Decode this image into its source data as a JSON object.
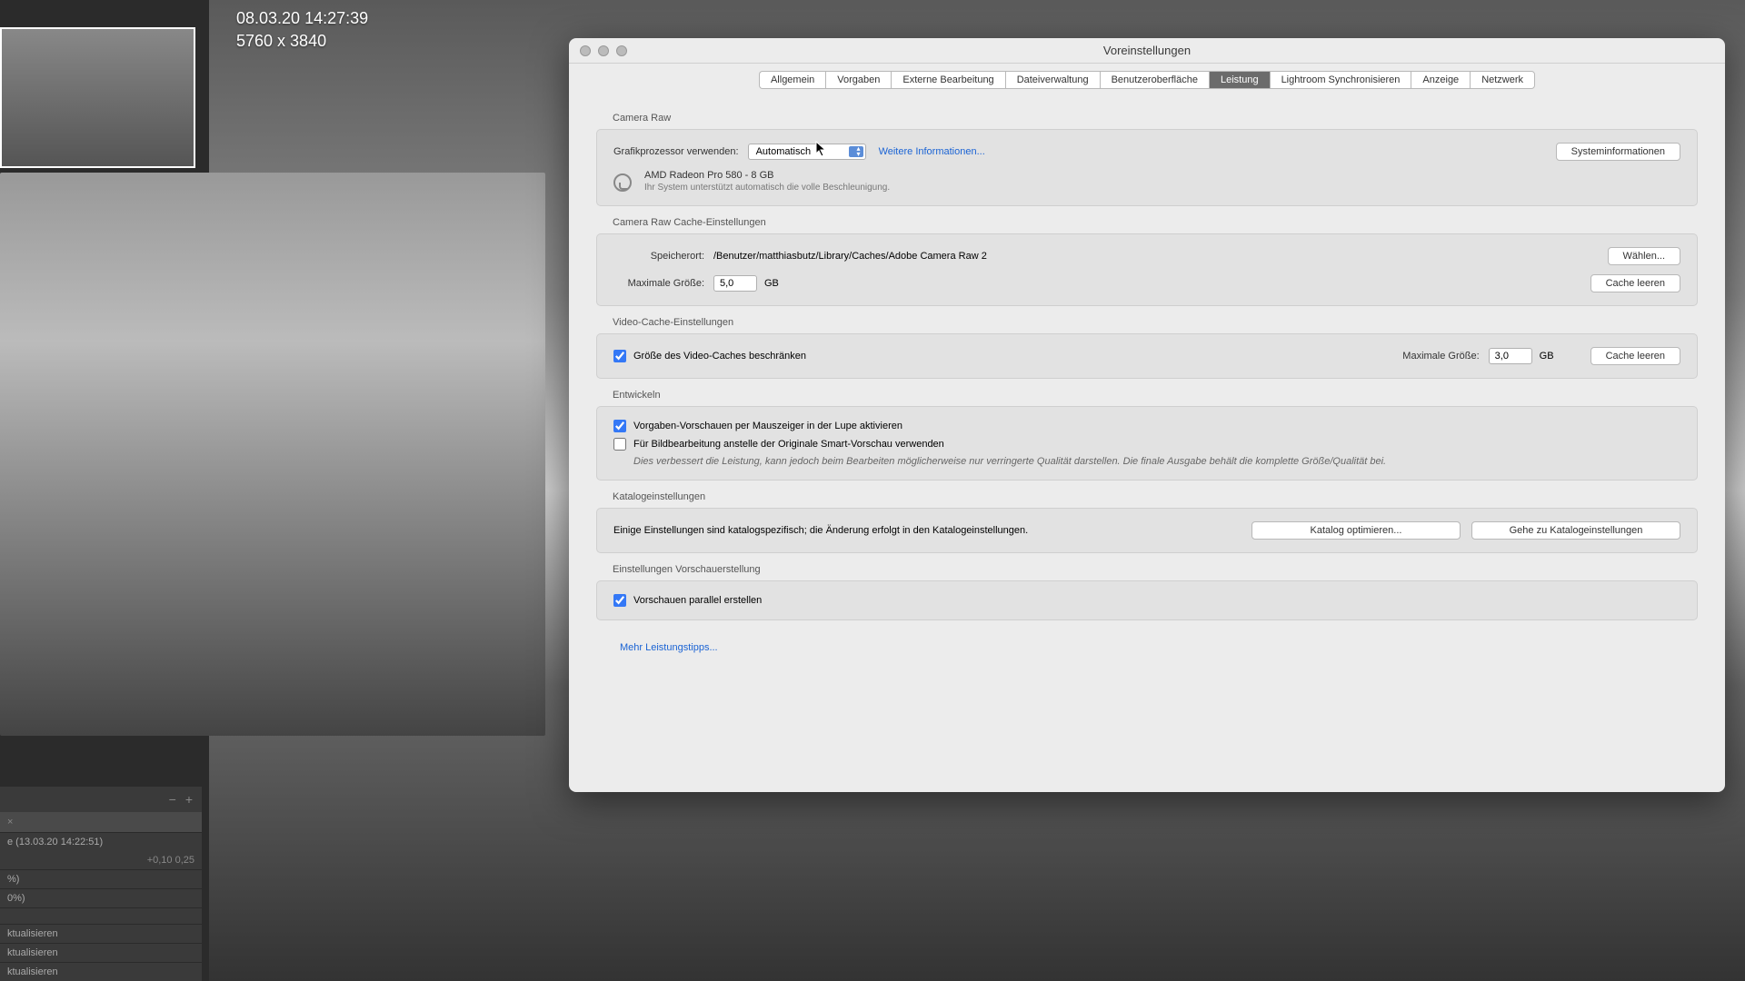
{
  "overlay": {
    "timestamp": "08.03.20 14:27:39",
    "dimensions": "5760 x 3840"
  },
  "history": {
    "plus": "+",
    "minus": "−",
    "close": "×",
    "title": "e (13.03.20 14:22:51)",
    "vals": "+0,10    0,25",
    "r1": "%)",
    "r2": "0%)",
    "a1": "ktualisieren",
    "a2": "ktualisieren",
    "a3": "ktualisieren"
  },
  "dialog": {
    "title": "Voreinstellungen",
    "tabs": [
      "Allgemein",
      "Vorgaben",
      "Externe Bearbeitung",
      "Dateiverwaltung",
      "Benutzeroberfläche",
      "Leistung",
      "Lightroom Synchronisieren",
      "Anzeige",
      "Netzwerk"
    ],
    "active_tab": 5,
    "sections": {
      "camera_raw": {
        "label": "Camera Raw",
        "gpu_label": "Grafikprozessor verwenden:",
        "gpu_value": "Automatisch",
        "more_info": "Weitere Informationen...",
        "sysinfo_btn": "Systeminformationen",
        "gpu_name": "AMD Radeon Pro 580 - 8 GB",
        "gpu_note": "Ihr System unterstützt automatisch die volle Beschleunigung."
      },
      "cache": {
        "label": "Camera Raw Cache-Einstellungen",
        "loc_label": "Speicherort:",
        "loc_value": "/Benutzer/matthiasbutz/Library/Caches/Adobe Camera Raw 2",
        "choose_btn": "Wählen...",
        "size_label": "Maximale Größe:",
        "size_value": "5,0",
        "gb": "GB",
        "clear_btn": "Cache leeren"
      },
      "video": {
        "label": "Video-Cache-Einstellungen",
        "limit_cb": "Größe des Video-Caches beschränken",
        "size_label": "Maximale Größe:",
        "size_value": "3,0",
        "gb": "GB",
        "clear_btn": "Cache leeren"
      },
      "develop": {
        "label": "Entwickeln",
        "cb1": "Vorgaben-Vorschauen per Mauszeiger in der Lupe aktivieren",
        "cb2": "Für Bildbearbeitung anstelle der Originale Smart-Vorschau verwenden",
        "note": "Dies verbessert die Leistung, kann jedoch beim Bearbeiten möglicherweise nur verringerte Qualität darstellen. Die finale Ausgabe behält die komplette Größe/Qualität bei."
      },
      "catalog": {
        "label": "Katalogeinstellungen",
        "text": "Einige Einstellungen sind katalogspezifisch; die Änderung erfolgt in den Katalogeinstellungen.",
        "opt_btn": "Katalog optimieren...",
        "goto_btn": "Gehe zu Katalogeinstellungen"
      },
      "preview": {
        "label": "Einstellungen Vorschauerstellung",
        "cb": "Vorschauen parallel erstellen"
      }
    },
    "more_tips": "Mehr Leistungstipps..."
  }
}
